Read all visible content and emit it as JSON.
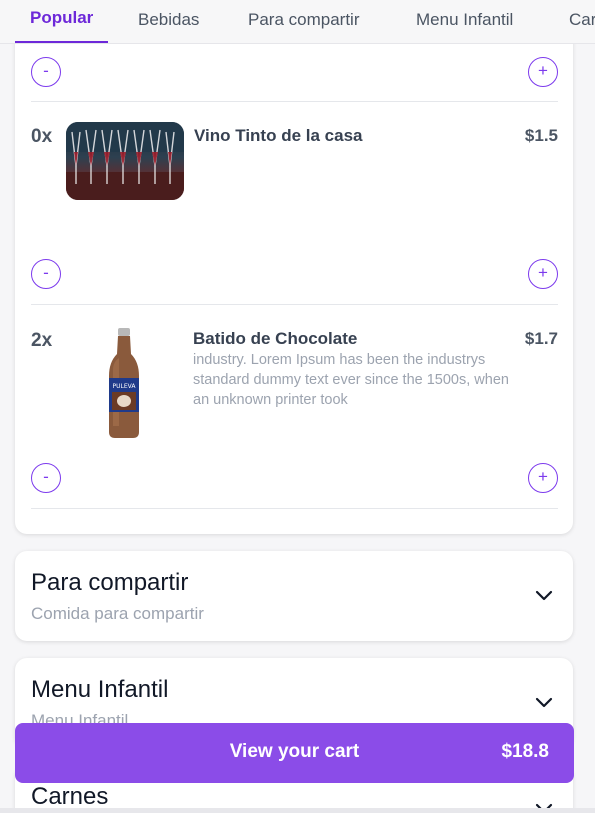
{
  "tabs": [
    {
      "label": "Popular",
      "active": true
    },
    {
      "label": "Bebidas",
      "active": false
    },
    {
      "label": "Para compartir",
      "active": false
    },
    {
      "label": "Menu Infantil",
      "active": false
    },
    {
      "label": "Carnes",
      "active": false
    }
  ],
  "stepper": {
    "minus": "-",
    "plus": "+"
  },
  "items": [
    {
      "qty": "0x",
      "name": "Vino Tinto de la casa",
      "price": "$1.5",
      "description": "",
      "image_icon": "wine-glasses-photo"
    },
    {
      "qty": "2x",
      "name": "Batido de Chocolate",
      "price": "$1.7",
      "description": "industry. Lorem Ipsum has been the industrys standard dummy text ever since the 1500s, when an unknown printer took",
      "image_icon": "milkshake-bottle-photo"
    }
  ],
  "categories": [
    {
      "title": "Para compartir",
      "subtitle": "Comida para compartir"
    },
    {
      "title": "Menu Infantil",
      "subtitle": "Menu Infantil"
    },
    {
      "title": "Carnes",
      "subtitle": ""
    }
  ],
  "cart": {
    "label": "View your cart",
    "total": "$18.8"
  },
  "colors": {
    "accent": "#6d28d9",
    "cart_bar": "#8b4ce8"
  }
}
